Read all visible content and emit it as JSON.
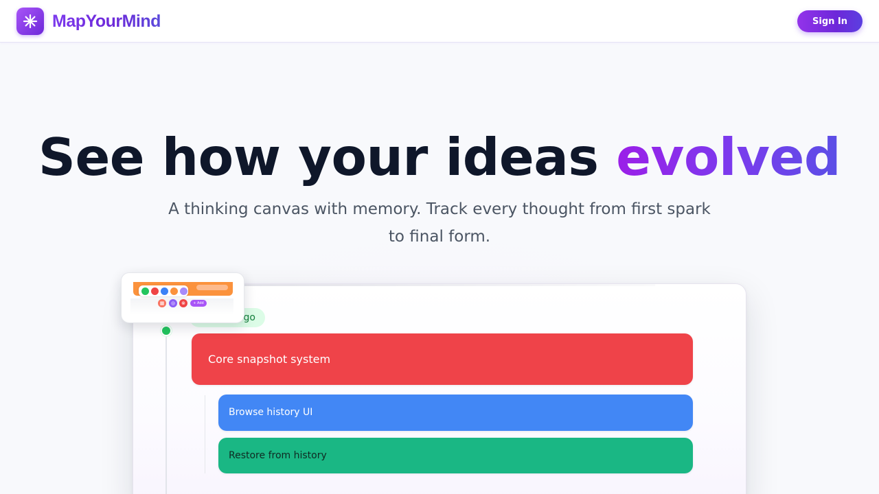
{
  "header": {
    "brand": "MapYourMind",
    "sign_in_label": "Sign In",
    "logo_icon": "sparkle-icon"
  },
  "hero": {
    "headline_main": "See how your ideas ",
    "headline_accent": "evolved",
    "subheadline": "A thinking canvas with memory. Track every thought from first spark to final form."
  },
  "preview": {
    "time_badge": "go",
    "nodes": [
      {
        "label": "Core snapshot system",
        "color": "#ef4349"
      },
      {
        "label": "Browse history UI",
        "color": "#4287f5"
      },
      {
        "label": "Restore from history",
        "color": "#1ab784"
      }
    ],
    "thumbnail": {
      "swatches": [
        "#22c55e",
        "#ef4444",
        "#3b82f6",
        "#fb923c",
        "#a78bfa"
      ],
      "action_button": "+ Add"
    }
  },
  "colors": {
    "brand_purple": "#7c3aed",
    "headline_dark": "#0f172a",
    "subtext_gray": "#4b5563"
  }
}
